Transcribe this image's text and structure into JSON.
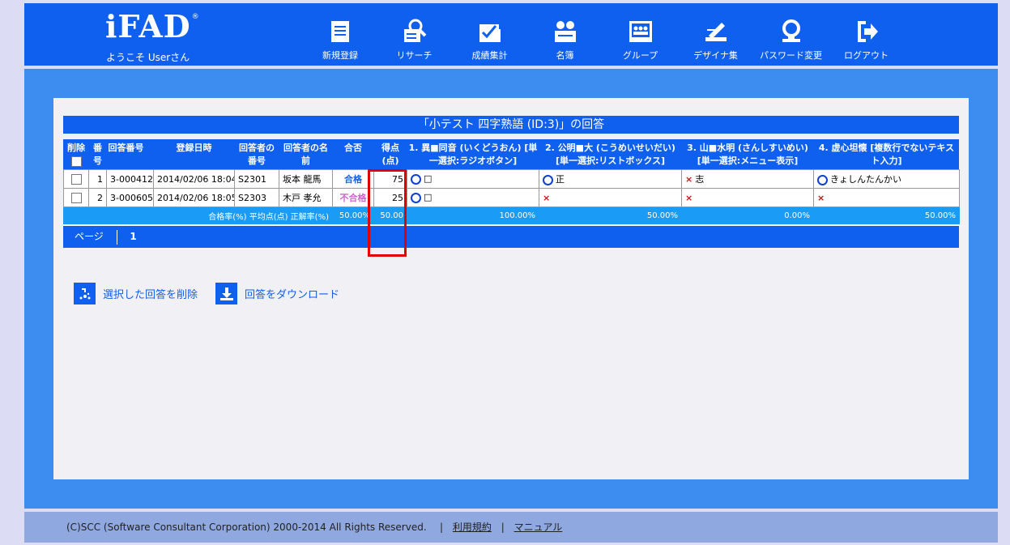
{
  "header": {
    "logo": "iFAD",
    "logo_mark": "®",
    "welcome": "ようこそ Userさん",
    "nav": [
      {
        "label": "新規登録",
        "icon": "document-icon"
      },
      {
        "label": "リサーチ",
        "icon": "research-icon"
      },
      {
        "label": "成績集計",
        "icon": "score-summary-icon"
      },
      {
        "label": "名簿",
        "icon": "roster-icon"
      },
      {
        "label": "グループ",
        "icon": "group-icon"
      },
      {
        "label": "デザイナ集",
        "icon": "designer-icon"
      },
      {
        "label": "パスワード変更",
        "icon": "password-icon"
      },
      {
        "label": "ログアウト",
        "icon": "logout-icon"
      }
    ]
  },
  "title": "「小テスト 四字熟語 (ID:3)」の回答",
  "table": {
    "headers": {
      "delete": "削除",
      "no": "番号",
      "answer_no": "回答番号",
      "date": "登録日時",
      "respondent_no": "回答者の番号",
      "respondent_name": "回答者の名前",
      "pass": "合否",
      "score": "得点(点)",
      "q1": "1. 異■同音 (いくどうおん) [単一選択:ラジオボタン]",
      "q2": "2. 公明■大 (こうめいせいだい) [単一選択:リストボックス]",
      "q3": "3. 山■水明 (さんしすいめい) [単一選択:メニュー表示]",
      "q4": "4. 虚心坦懐 [複数行でないテキスト入力]"
    },
    "rows": [
      {
        "no": "1",
        "answer_no": "3-000412",
        "date": "2014/02/06 18:04",
        "respondent_no": "S2301",
        "name": "坂本 龍馬",
        "pass": "合格",
        "score": "75",
        "q1": "□",
        "q1_ok": true,
        "q2": "正",
        "q2_ok": true,
        "q3": "志",
        "q3_ok": false,
        "q4": "きょしんたんかい",
        "q4_ok": true
      },
      {
        "no": "2",
        "answer_no": "3-000605",
        "date": "2014/02/06 18:05",
        "respondent_no": "S2303",
        "name": "木戸 孝允",
        "pass": "不合格",
        "score": "25",
        "q1": "□",
        "q1_ok": true,
        "q2": "",
        "q2_ok": false,
        "q3": "",
        "q3_ok": false,
        "q4": "",
        "q4_ok": false
      }
    ],
    "stats": {
      "label": "合格率(%) 平均点(点) 正解率(%)",
      "pass_rate": "50.00%",
      "avg": "50.00",
      "q1": "100.00%",
      "q2": "50.00%",
      "q3": "0.00%",
      "q4": "50.00%"
    },
    "pager_label": "ページ",
    "pager_current": "1"
  },
  "actions": {
    "delete_selected": "選択した回答を削除",
    "download": "回答をダウンロード"
  },
  "footer": {
    "copyright": "(C)SCC (Software Consultant Corporation) 2000-2014 All Rights Reserved.",
    "terms": "利用規約",
    "manual": "マニュアル",
    "sep": "|"
  }
}
